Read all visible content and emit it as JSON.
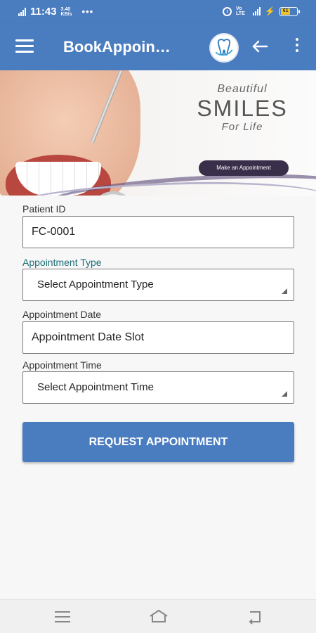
{
  "status_bar": {
    "time": "11:43",
    "network_speed": "3.40 KB/s",
    "volte": "Vo LTE",
    "battery": "61",
    "battery_level": 0.61,
    "battery_color": "#f2c22a"
  },
  "app_bar": {
    "title": "BookAppoin…",
    "background": "#4a7cc0",
    "menu_icon": "hamburger-menu-icon",
    "logo_icon": "dental-logo-icon",
    "back_icon": "back-arrow-icon",
    "more_icon": "more-vert-icon"
  },
  "banner": {
    "line1": "Beautiful",
    "line2": "SMILES",
    "line3": "For Life",
    "button_label": "Make an Appointment"
  },
  "form": {
    "patient_id_label": "Patient ID",
    "patient_id_value": "FC-0001",
    "type_label": "Appointment Type",
    "type_selected": "Select Appointment Type",
    "date_label": "Appointment Date",
    "date_value": "Appointment Date Slot",
    "time_label": "Appointment Time",
    "time_selected": "Select Appointment Time",
    "submit_label": "REQUEST APPOINTMENT",
    "accent_color": "#4a7cc0"
  },
  "nav_bar": {
    "recents_icon": "recents-icon",
    "home_icon": "home-icon",
    "back_icon": "nav-back-icon"
  }
}
